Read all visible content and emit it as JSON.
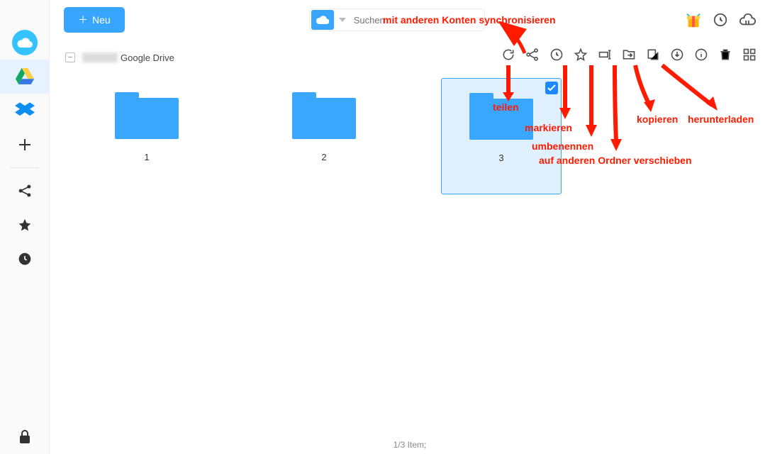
{
  "window": {
    "titlebar_dots": [
      "red",
      "yellow",
      "green"
    ]
  },
  "sidebar": {
    "items": [
      {
        "name": "app-logo",
        "label": "app"
      },
      {
        "name": "google-drive",
        "label": "Google Drive"
      },
      {
        "name": "dropbox",
        "label": "Dropbox"
      },
      {
        "name": "add-cloud",
        "label": "+"
      }
    ],
    "share_label": "share",
    "star_label": "star",
    "history_label": "history",
    "lock_label": "lock"
  },
  "topbar": {
    "neu_plus": "＋",
    "neu_label": "Neu",
    "search_placeholder": "Suchen"
  },
  "breadcrumb": {
    "collapse_symbol": "–",
    "service_label": "Google Drive"
  },
  "action_icons": [
    "refresh",
    "share",
    "history",
    "star",
    "rename",
    "move",
    "copy",
    "download",
    "info",
    "delete",
    "grid"
  ],
  "folders": [
    {
      "label": "1",
      "selected": false
    },
    {
      "label": "2",
      "selected": false
    },
    {
      "label": "3",
      "selected": true
    }
  ],
  "annotations": {
    "sync": "mit anderen Konten synchronisieren",
    "share": "teilen",
    "mark": "markieren",
    "rename": "umbenennen",
    "move": "auf anderen Ordner verschieben",
    "copy": "kopieren",
    "download": "herunterladen"
  },
  "status": "1/3 Item;"
}
